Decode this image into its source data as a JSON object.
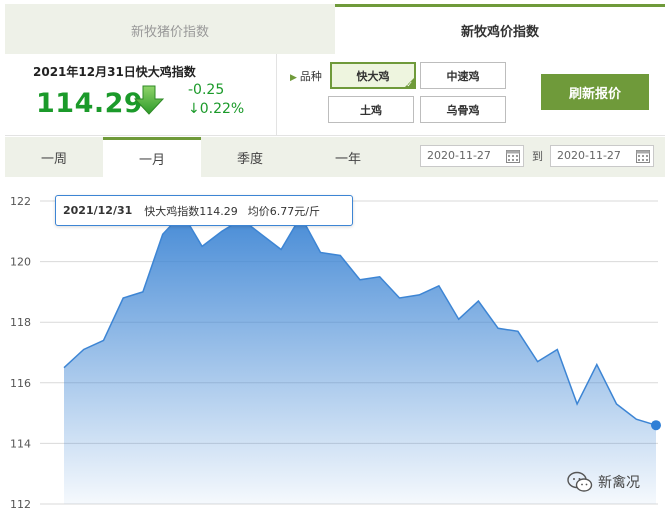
{
  "top_tabs": [
    {
      "label": "新牧猪价指数",
      "active": false
    },
    {
      "label": "新牧鸡价指数",
      "active": true
    }
  ],
  "index": {
    "title": "2021年12月31日快大鸡指数",
    "value": "114.29",
    "change": "-0.25",
    "change_pct": "↓0.22%",
    "trend_icon": "arrow-down-icon"
  },
  "breed": {
    "label": "品种",
    "options": [
      "快大鸡",
      "中速鸡",
      "土鸡",
      "乌骨鸡"
    ],
    "selected": "快大鸡"
  },
  "refresh_label": "刷新报价",
  "period_tabs": [
    {
      "label": "一周",
      "active": false
    },
    {
      "label": "一月",
      "active": true
    },
    {
      "label": "季度",
      "active": false
    },
    {
      "label": "一年",
      "active": false
    }
  ],
  "date_range": {
    "from": "2020-11-27",
    "to_label": "到",
    "to": "2020-11-27"
  },
  "tooltip": {
    "date": "2021/12/31",
    "index_text": "快大鸡指数114.29",
    "price_text": "均价6.77元/斤"
  },
  "watermark": "新禽况",
  "colors": {
    "accent": "#6f9a3a",
    "down": "#1b9a2a",
    "series": "#3d85d4"
  },
  "chart_data": {
    "type": "area",
    "title": "",
    "xlabel": "",
    "ylabel": "",
    "ylim": [
      112,
      122
    ],
    "yticks": [
      112,
      114,
      116,
      118,
      120,
      122
    ],
    "grid": true,
    "values": [
      116.5,
      117.1,
      117.4,
      118.8,
      119.0,
      120.9,
      121.6,
      120.5,
      121.0,
      121.4,
      120.9,
      120.4,
      121.5,
      120.3,
      120.2,
      119.4,
      119.5,
      118.8,
      118.9,
      119.2,
      118.1,
      118.7,
      117.8,
      117.7,
      116.7,
      117.1,
      115.3,
      116.6,
      115.3,
      114.8,
      114.6
    ]
  }
}
